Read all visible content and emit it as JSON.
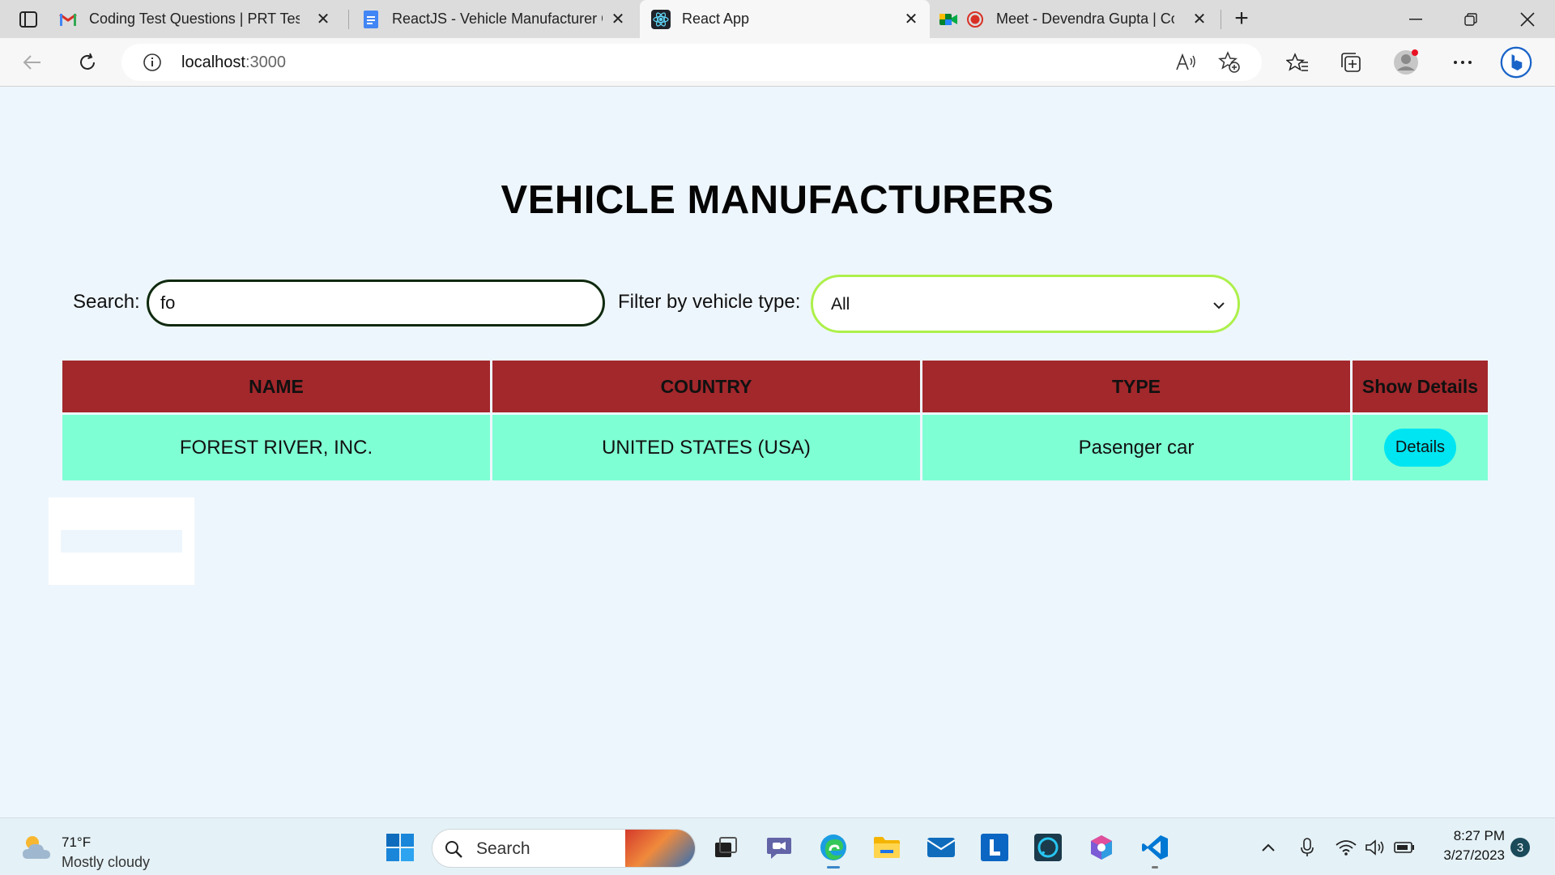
{
  "browser": {
    "tabs": [
      {
        "title": "Coding Test Questions | PRT Test",
        "icon": "gmail-icon"
      },
      {
        "title": "ReactJS - Vehicle Manufacturer C",
        "icon": "docs-icon"
      },
      {
        "title": "React App",
        "icon": "react-icon"
      },
      {
        "title": "Meet - Devendra Gupta | Co",
        "icon": "meet-icon"
      }
    ],
    "url_host": "localhost",
    "url_port": ":3000"
  },
  "page": {
    "title": "VEHICLE MANUFACTURERS",
    "search": {
      "label": "Search:",
      "value": "fo"
    },
    "filter": {
      "label": "Filter by vehicle type:",
      "selected": "All"
    },
    "table": {
      "headers": [
        "NAME",
        "COUNTRY",
        "TYPE",
        "Show Details"
      ],
      "rows": [
        {
          "name": "FOREST RIVER, INC.",
          "country": "UNITED STATES (USA)",
          "type": "Pasenger car",
          "action": "Details"
        }
      ]
    }
  },
  "taskbar": {
    "weather": {
      "temp": "71°F",
      "condition": "Mostly cloudy"
    },
    "search_placeholder": "Search",
    "time": "8:27 PM",
    "date": "3/27/2023",
    "notification_count": "3"
  },
  "colors": {
    "header_bg": "#a2282b",
    "row_bg": "#7fffd4",
    "details_button": "#00e5f2",
    "filter_border": "#adf04a"
  }
}
